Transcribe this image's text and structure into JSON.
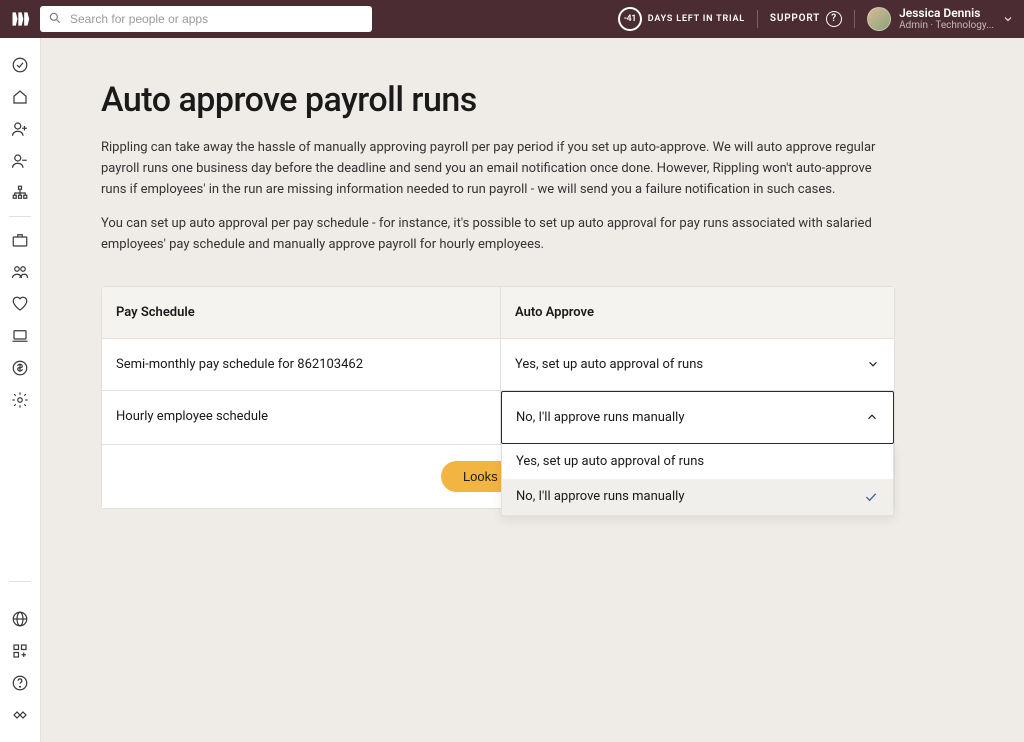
{
  "header": {
    "search_placeholder": "Search for people or apps",
    "trial_days": "-41",
    "trial_label": "DAYS LEFT IN TRIAL",
    "support_label": "SUPPORT",
    "user_name": "Jessica Dennis",
    "user_role": "Admin · Technology..."
  },
  "page": {
    "title": "Auto approve payroll runs",
    "paragraph1": "Rippling can take away the hassle of manually approving payroll per pay period if you set up auto-approve. We will auto approve regular payroll runs one business day before the deadline and send you an email notification once done. However, Rippling won't auto-approve runs if employees' in the run are missing information needed to run payroll - we will send you a failure notification in such cases.",
    "paragraph2": "You can set up auto approval per pay schedule - for instance, it's possible to set up auto approval for pay runs associated with salaried employees' pay schedule and manually approve payroll for hourly employees."
  },
  "table": {
    "col_a_header": "Pay Schedule",
    "col_b_header": "Auto Approve",
    "rows": [
      {
        "schedule": "Semi-monthly pay schedule for 862103462",
        "selected": "Yes, set up auto approval of runs"
      },
      {
        "schedule": "Hourly employee schedule",
        "selected": "No, I'll approve runs manually"
      }
    ],
    "dropdown_options": [
      "Yes, set up auto approval of runs",
      "No, I'll approve runs manually"
    ],
    "cta_label": "Looks Good"
  }
}
